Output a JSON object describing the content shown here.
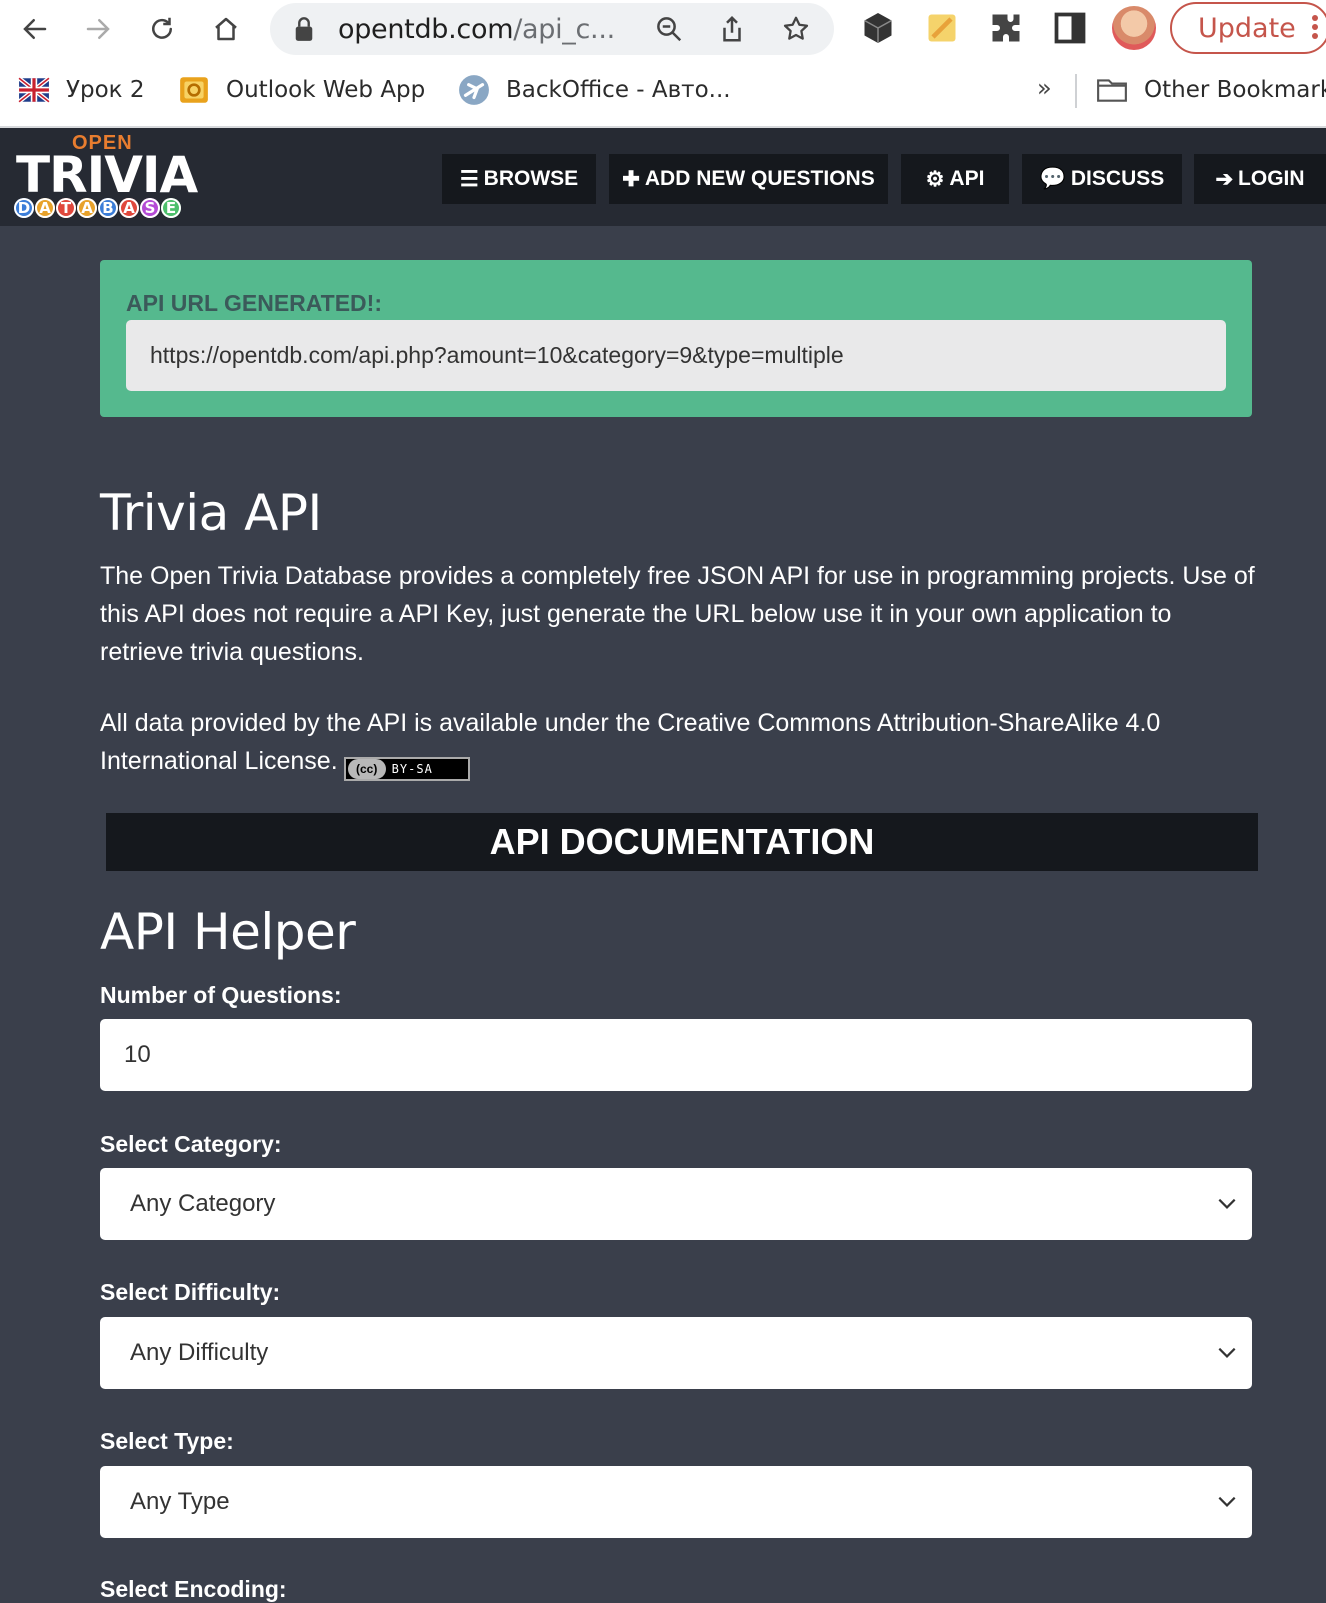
{
  "browser": {
    "url_host": "opentdb.com",
    "url_path": "/api_c...",
    "update_label": "Update",
    "bookmarks": [
      {
        "label": "Урок 2"
      },
      {
        "label": "Outlook Web App"
      },
      {
        "label": "BackOffice - Авто..."
      }
    ],
    "more_bookmarks": "»",
    "other_bookmarks": "Other Bookmark"
  },
  "site": {
    "logo": {
      "open": "OPEN",
      "trivia": "TRIVIA",
      "database_letters": [
        "D",
        "A",
        "T",
        "A",
        "B",
        "A",
        "S",
        "E"
      ]
    },
    "nav": [
      {
        "label": "BROWSE",
        "icon": "bars-icon"
      },
      {
        "label": "ADD NEW QUESTIONS",
        "icon": "plus-icon"
      },
      {
        "label": "API",
        "icon": "gears-icon"
      },
      {
        "label": "DISCUSS",
        "icon": "comments-icon"
      },
      {
        "label": "LOGIN",
        "icon": "sign-in-icon"
      }
    ]
  },
  "api_generated": {
    "label": "API URL GENERATED!:",
    "url": "https://opentdb.com/api.php?amount=10&category=9&type=multiple"
  },
  "intro": {
    "title": "Trivia API",
    "paragraph1": "The Open Trivia Database provides a completely free JSON API for use in programming projects. Use of this API does not require a API Key, just generate the URL below use it in your own application to retrieve trivia questions.",
    "paragraph2": "All data provided by the API is available under the Creative Commons Attribution-ShareAlike 4.0 International License.",
    "badge_cc": "(cc)",
    "badge_bysa": "BY-SA"
  },
  "docs_banner": "API DOCUMENTATION",
  "helper": {
    "title": "API Helper",
    "number_label": "Number of Questions:",
    "number_value": "10",
    "category_label": "Select Category:",
    "category_value": "Any Category",
    "difficulty_label": "Select Difficulty:",
    "difficulty_value": "Any Difficulty",
    "type_label": "Select Type:",
    "type_value": "Any Type",
    "encoding_label": "Select Encoding:"
  },
  "colors": {
    "page_bg": "#3a3f4b",
    "nav_bg": "#262a33",
    "button_bg": "#15181d",
    "success_box": "#55b98e",
    "update_red": "#c5554b"
  }
}
